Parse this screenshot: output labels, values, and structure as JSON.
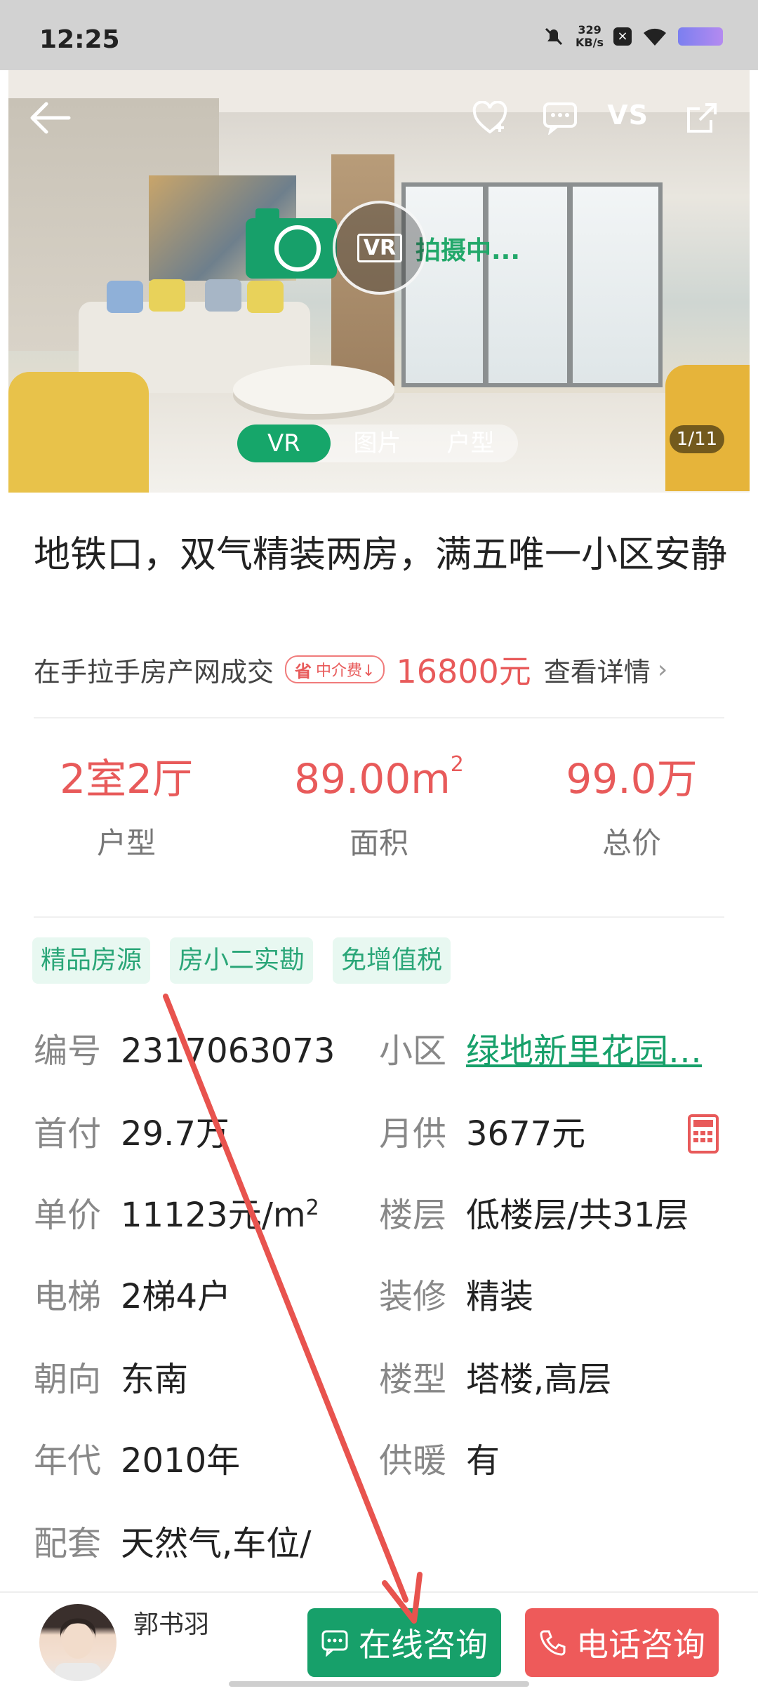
{
  "status_bar": {
    "time": "12:25",
    "net_speed_value": "329",
    "net_speed_unit": "KB/s"
  },
  "hero": {
    "vs_label": "VS",
    "vr_text": "VR",
    "shooting_text": "拍摄中...",
    "tabs": [
      {
        "label": "VR",
        "active": true
      },
      {
        "label": "图片",
        "active": false
      },
      {
        "label": "户型",
        "active": false
      }
    ],
    "counter": "1/11"
  },
  "listing": {
    "title": "地铁口，双气精装两房，满五唯一小区安静",
    "deal_text": "在手拉手房产网成交",
    "fee_badge_symbol": "省",
    "fee_badge_text": "中介费↓",
    "fee_price": "16800元",
    "detail_link": "查看详情",
    "stats": [
      {
        "value": "2室2厅",
        "label": "户型"
      },
      {
        "value": "89.00m",
        "sup": "2",
        "label": "面积"
      },
      {
        "value": "99.0万",
        "label": "总价"
      }
    ],
    "tags": [
      "精品房源",
      "房小二实勘",
      "免增值税"
    ],
    "details": {
      "code_key": "编号",
      "code_val": "2317063073",
      "community_key": "小区",
      "community_val": "绿地新里花园…",
      "downpay_key": "首付",
      "downpay_val": "29.7万",
      "monthly_key": "月供",
      "monthly_val": "3677元",
      "unit_price_key": "单价",
      "unit_price_val": "11123元/m",
      "unit_price_sup": "2",
      "floor_key": "楼层",
      "floor_val": "低楼层/共31层",
      "elevator_key": "电梯",
      "elevator_val": "2梯4户",
      "decor_key": "装修",
      "decor_val": "精装",
      "orient_key": "朝向",
      "orient_val": "东南",
      "building_key": "楼型",
      "building_val": "塔楼,高层",
      "year_key": "年代",
      "year_val": "2010年",
      "heating_key": "供暖",
      "heating_val": "有",
      "facility_key": "配套",
      "facility_val": "天然气,车位/"
    }
  },
  "bottom_bar": {
    "agent_name": "郭书羽",
    "online_button": "在线咨询",
    "phone_button": "电话咨询"
  },
  "colors": {
    "accent_green": "#17a06a",
    "accent_red": "#e85a5a",
    "annotation_arrow": "#e8534e"
  }
}
